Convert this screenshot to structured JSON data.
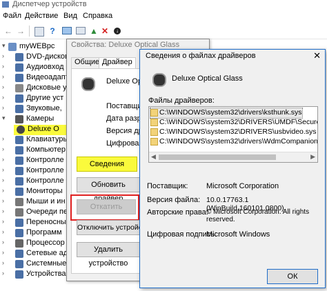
{
  "window": {
    "title": "Диспетчер устройств"
  },
  "menu": [
    "Файл",
    "Действие",
    "Вид",
    "Справка"
  ],
  "toolbar_icons": [
    "back-icon",
    "forward-icon",
    "properties-icon",
    "help-icon",
    "computer-icon",
    "scan-icon",
    "update-icon",
    "remove-icon",
    "download-icon"
  ],
  "tree": {
    "root": "myWEBpc",
    "items": [
      "DVD-дисково",
      "Аудиовход",
      "Видеоадапт",
      "Дисковые у",
      "Другие уст",
      "Звуковые,",
      "Камеры",
      "Deluxe O",
      "Клавиатуры",
      "Компьютер",
      "Контролле",
      "Контролле",
      "Контролле",
      "Мониторы",
      "Мыши и ин",
      "Очереди пе",
      "Переносны",
      "Программ",
      "Процессор",
      "Сетевые ад",
      "Системные",
      "Устройства"
    ]
  },
  "properties": {
    "title": "Свойства: Deluxe Optical Glass",
    "tabs": [
      "Общие",
      "Драйвер"
    ],
    "device_name": "Deluxe Optical",
    "labels": [
      "Поставщик дра",
      "Дата разработ",
      "Версия драйве",
      "Цифровая под"
    ],
    "buttons": {
      "details": "Сведения",
      "update": "Обновить драйвер",
      "rollback": "Откатить",
      "disable": "Отключить устройств",
      "remove": "Удалить устройство"
    }
  },
  "files": {
    "title": "Сведения о файлах драйверов",
    "device_name": "Deluxe Optical Glass",
    "list_label": "Файлы драйверов:",
    "list": [
      "C:\\WINDOWS\\system32\\drivers\\ksthunk.sys",
      "C:\\WINDOWS\\system32\\DRIVERS\\UMDF\\SecureUSBVide",
      "C:\\WINDOWS\\system32\\DRIVERS\\usbvideo.sys",
      "C:\\WINDOWS\\system32\\drivers\\WdmCompanionFilter.sys"
    ],
    "provider_label": "Поставщик:",
    "provider": "Microsoft Corporation",
    "version_label": "Версия файла:",
    "version": "10.0.17763.1 (WinBuild.160101.0800)",
    "copyright_label": "Авторские права:",
    "copyright": "© Microsoft Corporation. All rights reserved.",
    "signer_label": "Цифровая подпись:",
    "signer": "Microsoft Windows",
    "ok": "ОК"
  },
  "colors": {
    "highlight": "#fafa3c",
    "annotation_red": "#e02020",
    "accent": "#1e6cc8"
  }
}
